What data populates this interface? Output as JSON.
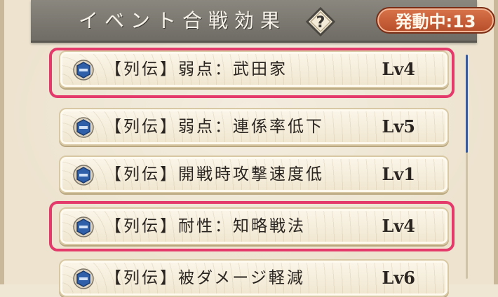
{
  "header": {
    "title": "イベント合戦効果",
    "help_symbol": "?",
    "active_badge": "発動中:13"
  },
  "effects": [
    {
      "label": "【列伝】弱点：武田家",
      "level": "Lv4",
      "highlighted": true
    },
    {
      "label": "【列伝】弱点：連係率低下",
      "level": "Lv5",
      "highlighted": false
    },
    {
      "label": "【列伝】開戦時攻撃速度低",
      "level": "Lv1",
      "highlighted": false
    },
    {
      "label": "【列伝】耐性：知略戦法",
      "level": "Lv4",
      "highlighted": true
    },
    {
      "label": "【列伝】被ダメージ軽減",
      "level": "Lv6",
      "highlighted": false
    }
  ],
  "colors": {
    "highlight": "#e33a6b",
    "badge": "#c65f36",
    "icon": "#2f5fa8"
  }
}
